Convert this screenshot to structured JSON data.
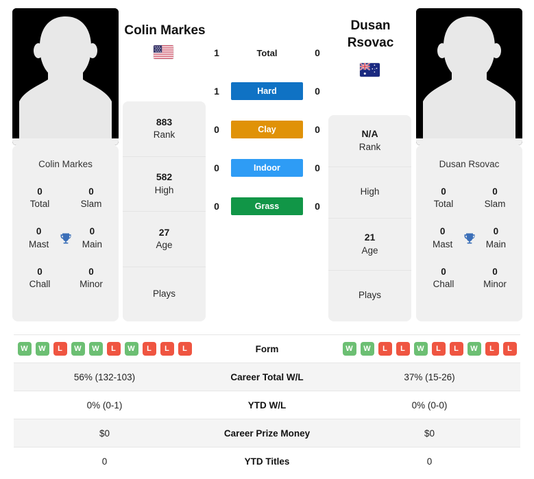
{
  "players": {
    "left": {
      "name": "Colin Markes",
      "flag": "us-flag-icon",
      "card_name": "Colin Markes",
      "titles": {
        "total_val": "0",
        "total_lbl": "Total",
        "slam_val": "0",
        "slam_lbl": "Slam",
        "mast_val": "0",
        "mast_lbl": "Mast",
        "main_val": "0",
        "main_lbl": "Main",
        "chall_val": "0",
        "chall_lbl": "Chall",
        "minor_val": "0",
        "minor_lbl": "Minor"
      },
      "rank_val": "883",
      "rank_lbl": "Rank",
      "high_val": "582",
      "high_lbl": "High",
      "age_val": "27",
      "age_lbl": "Age",
      "plays_val": "",
      "plays_lbl": "Plays",
      "surface_scores": {
        "total": "1",
        "hard": "1",
        "clay": "0",
        "indoor": "0",
        "grass": "0"
      },
      "form": [
        "W",
        "W",
        "L",
        "W",
        "W",
        "L",
        "W",
        "L",
        "L",
        "L"
      ],
      "career_wl": "56% (132-103)",
      "ytd_wl": "0% (0-1)",
      "prize_money": "$0",
      "ytd_titles": "0"
    },
    "right": {
      "name": "Dusan Rsovac",
      "name_line1": "Dusan",
      "name_line2": "Rsovac",
      "flag": "au-flag-icon",
      "card_name": "Dusan Rsovac",
      "titles": {
        "total_val": "0",
        "total_lbl": "Total",
        "slam_val": "0",
        "slam_lbl": "Slam",
        "mast_val": "0",
        "mast_lbl": "Mast",
        "main_val": "0",
        "main_lbl": "Main",
        "chall_val": "0",
        "chall_lbl": "Chall",
        "minor_val": "0",
        "minor_lbl": "Minor"
      },
      "rank_val": "N/A",
      "rank_lbl": "Rank",
      "high_val": "",
      "high_lbl": "High",
      "age_val": "21",
      "age_lbl": "Age",
      "plays_val": "",
      "plays_lbl": "Plays",
      "surface_scores": {
        "total": "0",
        "hard": "0",
        "clay": "0",
        "indoor": "0",
        "grass": "0"
      },
      "form": [
        "W",
        "W",
        "L",
        "L",
        "W",
        "L",
        "L",
        "W",
        "L",
        "L"
      ],
      "career_wl": "37% (15-26)",
      "ytd_wl": "0% (0-0)",
      "prize_money": "$0",
      "ytd_titles": "0"
    }
  },
  "surfaces": [
    {
      "key": "total",
      "label": "Total",
      "color": "transparent",
      "text_color": "#1a1a1a",
      "plain": true
    },
    {
      "key": "hard",
      "label": "Hard",
      "color": "#0f72c4",
      "text_color": "#ffffff",
      "plain": false
    },
    {
      "key": "clay",
      "label": "Clay",
      "color": "#e09208",
      "text_color": "#ffffff",
      "plain": false
    },
    {
      "key": "indoor",
      "label": "Indoor",
      "color": "#2e9cf5",
      "text_color": "#ffffff",
      "plain": false
    },
    {
      "key": "grass",
      "label": "Grass",
      "color": "#119647",
      "text_color": "#ffffff",
      "plain": false
    }
  ],
  "table": {
    "rows": [
      {
        "label": "Form",
        "type": "form"
      },
      {
        "label": "Career Total W/L",
        "type": "text",
        "key": "career_wl"
      },
      {
        "label": "YTD W/L",
        "type": "text",
        "key": "ytd_wl"
      },
      {
        "label": "Career Prize Money",
        "type": "text",
        "key": "prize_money"
      },
      {
        "label": "YTD Titles",
        "type": "text",
        "key": "ytd_titles"
      }
    ]
  },
  "colors": {
    "win": "#6cbf73",
    "loss": "#ef5541",
    "card_bg": "#f0f0f0",
    "row_alt_bg": "#f4f4f4",
    "trophy": "#3b6fb8",
    "photo_bg": "#000000"
  }
}
